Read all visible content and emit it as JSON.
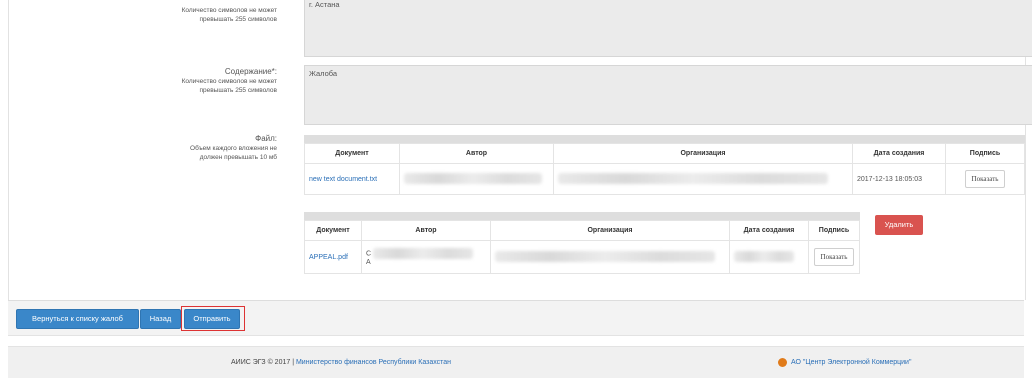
{
  "form": {
    "topic_hint": "Количество символов не может превышать 255 символов",
    "topic_value": "г. Астана",
    "content_label": "Содержание*:",
    "content_hint": "Количество символов не может превышать 255 символов",
    "content_value": "Жалоба",
    "file_label": "Файл:",
    "file_hint": "Объем каждого вложения не должен превышать 10 мб"
  },
  "table1": {
    "headers": [
      "Документ",
      "Автор",
      "Организация",
      "Дата создания",
      "Подпись"
    ],
    "row": {
      "document": "new text document.txt",
      "date": "2017-12-13 18:05:03",
      "sign_label": "Показать"
    }
  },
  "table2": {
    "headers": [
      "Документ",
      "Автор",
      "Организация",
      "Дата создания",
      "Подпись"
    ],
    "row": {
      "document": "APPEAL.pdf",
      "author_fragment": "С",
      "author_fragment2": "А",
      "sign_label": "Показать"
    },
    "delete_label": "Удалить"
  },
  "actions": {
    "back_to_list": "Вернуться к списку жалоб",
    "back": "Назад",
    "submit": "Отправить"
  },
  "footer": {
    "copyright": "АИИС ЭГЗ © 2017 |",
    "ministry": "Министерство финансов Республики Казахстан",
    "company": "АО \"Центр Электронной Коммерции\""
  }
}
